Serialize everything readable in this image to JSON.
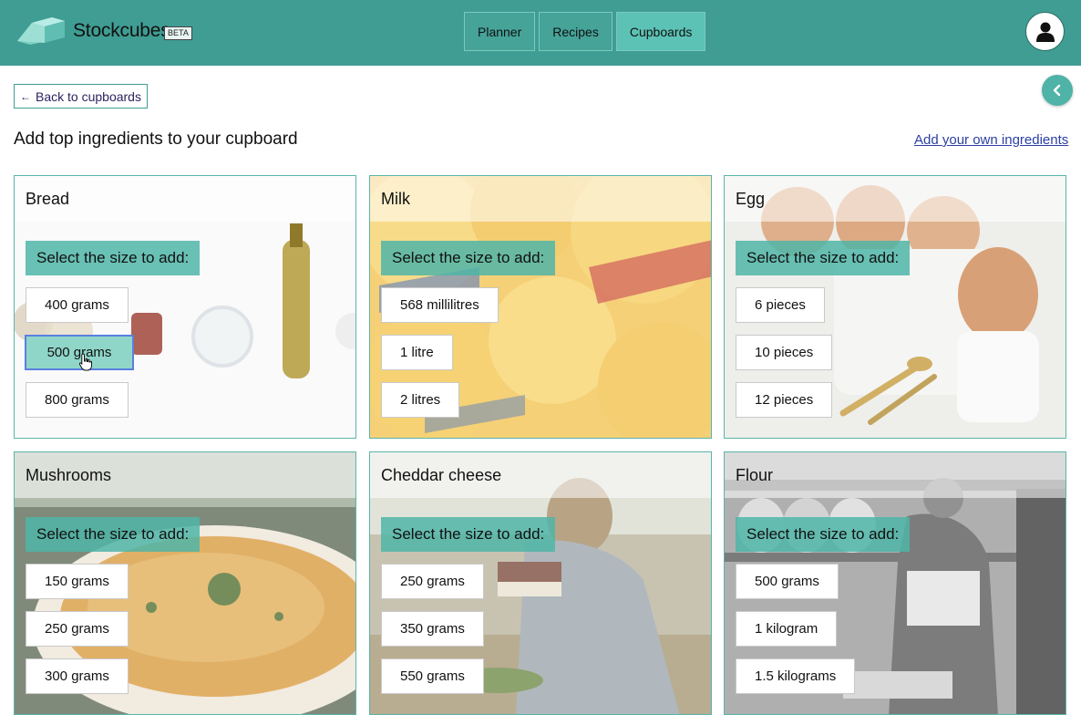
{
  "header": {
    "brand": "Stockcubes",
    "beta": "BETA",
    "nav": [
      {
        "label": "Planner",
        "active": false
      },
      {
        "label": "Recipes",
        "active": false
      },
      {
        "label": "Cupboards",
        "active": true
      }
    ],
    "avatar_icon": "user-icon"
  },
  "subheader": {
    "back_label": "Back to cupboards",
    "page_title": "Add top ingredients to your cupboard",
    "own_link": "Add your own ingredients",
    "collapse_icon": "chevron-left-icon"
  },
  "cards": [
    {
      "title": "Bread",
      "prompt": "Select the size to add:",
      "sizes": [
        "400 grams",
        "500 grams",
        "800 grams"
      ],
      "selected_index": 1
    },
    {
      "title": "Milk",
      "prompt": "Select the size to add:",
      "sizes": [
        "568 millilitres",
        "1 litre",
        "2 litres"
      ]
    },
    {
      "title": "Egg",
      "prompt": "Select the size to add:",
      "sizes": [
        "6 pieces",
        "10 pieces",
        "12 pieces"
      ]
    },
    {
      "title": "Mushrooms",
      "prompt": "Select the size to add:",
      "sizes": [
        "150 grams",
        "250 grams",
        "300 grams"
      ]
    },
    {
      "title": "Cheddar cheese",
      "prompt": "Select the size to add:",
      "sizes": [
        "250 grams",
        "350 grams",
        "550 grams"
      ]
    },
    {
      "title": "Flour",
      "prompt": "Select the size to add:",
      "sizes": [
        "500 grams",
        "1 kilogram",
        "1.5 kilograms"
      ]
    }
  ],
  "colors": {
    "accent": "#3f9d93",
    "select_bg": "#4fb5a7",
    "link": "#2b3fa3"
  }
}
